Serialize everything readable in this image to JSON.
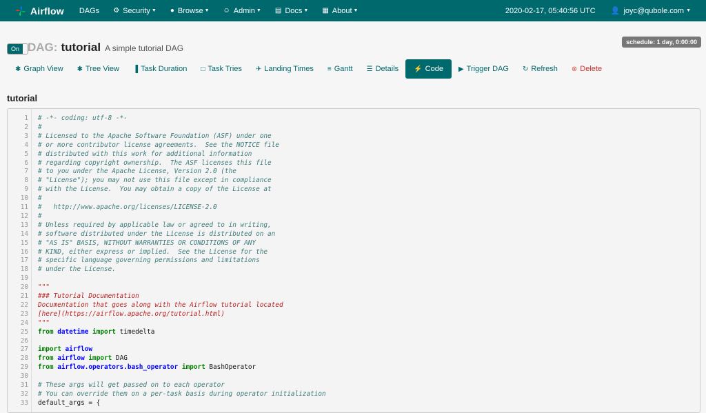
{
  "navbar": {
    "brand": "Airflow",
    "items": [
      {
        "label": "DAGs",
        "icon": "",
        "caret": false
      },
      {
        "label": "Security",
        "icon": "gear-icon",
        "caret": true
      },
      {
        "label": "Browse",
        "icon": "globe-icon",
        "caret": true
      },
      {
        "label": "Admin",
        "icon": "user-icon",
        "caret": true
      },
      {
        "label": "Docs",
        "icon": "book-icon",
        "caret": true
      },
      {
        "label": "About",
        "icon": "grid-icon",
        "caret": true
      }
    ],
    "timestamp": "2020-02-17, 05:40:56 UTC",
    "user": "joyc@qubole.com"
  },
  "dag": {
    "toggle_label": "On",
    "title_prefix": "DAG:",
    "dag_id": "tutorial",
    "description": "A simple tutorial DAG",
    "schedule": "schedule: 1 day, 0:00:00"
  },
  "tabs": [
    {
      "label": "Graph View",
      "icon": "graph-icon"
    },
    {
      "label": "Tree View",
      "icon": "tree-icon"
    },
    {
      "label": "Task Duration",
      "icon": "bar-chart-icon"
    },
    {
      "label": "Task Tries",
      "icon": "square-icon"
    },
    {
      "label": "Landing Times",
      "icon": "plane-icon"
    },
    {
      "label": "Gantt",
      "icon": "gantt-icon"
    },
    {
      "label": "Details",
      "icon": "list-icon"
    },
    {
      "label": "Code",
      "icon": "flash-icon",
      "active": true
    },
    {
      "label": "Trigger DAG",
      "icon": "play-icon"
    },
    {
      "label": "Refresh",
      "icon": "refresh-icon"
    },
    {
      "label": "Delete",
      "icon": "remove-icon",
      "danger": true
    }
  ],
  "section_title": "tutorial",
  "code": [
    {
      "n": "1",
      "parts": [
        [
          "c-comment",
          "# -*- coding: utf-8 -*-"
        ]
      ]
    },
    {
      "n": "2",
      "parts": [
        [
          "c-comment",
          "#"
        ]
      ]
    },
    {
      "n": "3",
      "parts": [
        [
          "c-comment",
          "# Licensed to the Apache Software Foundation (ASF) under one"
        ]
      ]
    },
    {
      "n": "4",
      "parts": [
        [
          "c-comment",
          "# or more contributor license agreements.  See the NOTICE file"
        ]
      ]
    },
    {
      "n": "5",
      "parts": [
        [
          "c-comment",
          "# distributed with this work for additional information"
        ]
      ]
    },
    {
      "n": "6",
      "parts": [
        [
          "c-comment",
          "# regarding copyright ownership.  The ASF licenses this file"
        ]
      ]
    },
    {
      "n": "7",
      "parts": [
        [
          "c-comment",
          "# to you under the Apache License, Version 2.0 (the"
        ]
      ]
    },
    {
      "n": "8",
      "parts": [
        [
          "c-comment",
          "# \"License\"); you may not use this file except in compliance"
        ]
      ]
    },
    {
      "n": "9",
      "parts": [
        [
          "c-comment",
          "# with the License.  You may obtain a copy of the License at"
        ]
      ]
    },
    {
      "n": "10",
      "parts": [
        [
          "c-comment",
          "#"
        ]
      ]
    },
    {
      "n": "11",
      "parts": [
        [
          "c-comment",
          "#   http://www.apache.org/licenses/LICENSE-2.0"
        ]
      ]
    },
    {
      "n": "12",
      "parts": [
        [
          "c-comment",
          "#"
        ]
      ]
    },
    {
      "n": "13",
      "parts": [
        [
          "c-comment",
          "# Unless required by applicable law or agreed to in writing,"
        ]
      ]
    },
    {
      "n": "14",
      "parts": [
        [
          "c-comment",
          "# software distributed under the License is distributed on an"
        ]
      ]
    },
    {
      "n": "15",
      "parts": [
        [
          "c-comment",
          "# \"AS IS\" BASIS, WITHOUT WARRANTIES OR CONDITIONS OF ANY"
        ]
      ]
    },
    {
      "n": "16",
      "parts": [
        [
          "c-comment",
          "# KIND, either express or implied.  See the License for the"
        ]
      ]
    },
    {
      "n": "17",
      "parts": [
        [
          "c-comment",
          "# specific language governing permissions and limitations"
        ]
      ]
    },
    {
      "n": "18",
      "parts": [
        [
          "c-comment",
          "# under the License."
        ]
      ]
    },
    {
      "n": "19",
      "parts": []
    },
    {
      "n": "20",
      "parts": [
        [
          "c-doc",
          "\"\"\""
        ]
      ]
    },
    {
      "n": "21",
      "parts": [
        [
          "c-doc",
          "### Tutorial Documentation"
        ]
      ]
    },
    {
      "n": "22",
      "parts": [
        [
          "c-doc",
          "Documentation that goes along with the Airflow tutorial located"
        ]
      ]
    },
    {
      "n": "23",
      "parts": [
        [
          "c-doc",
          "[here](https://airflow.apache.org/tutorial.html)"
        ]
      ]
    },
    {
      "n": "24",
      "parts": [
        [
          "c-doc",
          "\"\"\""
        ]
      ]
    },
    {
      "n": "25",
      "parts": [
        [
          "c-kw",
          "from"
        ],
        [
          "c-plain",
          " "
        ],
        [
          "c-mod",
          "datetime"
        ],
        [
          "c-plain",
          " "
        ],
        [
          "c-kw",
          "import"
        ],
        [
          "c-plain",
          " timedelta"
        ]
      ]
    },
    {
      "n": "26",
      "parts": []
    },
    {
      "n": "27",
      "parts": [
        [
          "c-kw",
          "import"
        ],
        [
          "c-plain",
          " "
        ],
        [
          "c-mod",
          "airflow"
        ]
      ]
    },
    {
      "n": "28",
      "parts": [
        [
          "c-kw",
          "from"
        ],
        [
          "c-plain",
          " "
        ],
        [
          "c-mod",
          "airflow"
        ],
        [
          "c-plain",
          " "
        ],
        [
          "c-kw",
          "import"
        ],
        [
          "c-plain",
          " DAG"
        ]
      ]
    },
    {
      "n": "29",
      "parts": [
        [
          "c-kw",
          "from"
        ],
        [
          "c-plain",
          " "
        ],
        [
          "c-mod",
          "airflow.operators.bash_operator"
        ],
        [
          "c-plain",
          " "
        ],
        [
          "c-kw",
          "import"
        ],
        [
          "c-plain",
          " BashOperator"
        ]
      ]
    },
    {
      "n": "30",
      "parts": []
    },
    {
      "n": "31",
      "parts": [
        [
          "c-comment",
          "# These args will get passed on to each operator"
        ]
      ]
    },
    {
      "n": "32",
      "parts": [
        [
          "c-comment",
          "# You can override them on a per-task basis during operator initialization"
        ]
      ]
    },
    {
      "n": "33",
      "parts": [
        [
          "c-plain",
          "default_args = {"
        ]
      ]
    }
  ],
  "colors": {
    "navbar": "#00696d",
    "accent": "#00696d",
    "danger": "#c9302c"
  }
}
